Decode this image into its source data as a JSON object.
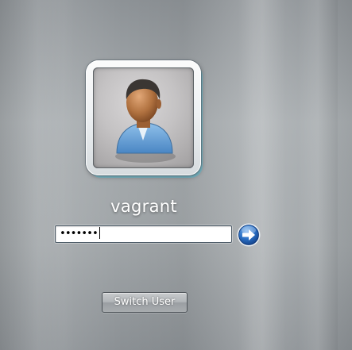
{
  "user": {
    "name": "vagrant"
  },
  "password_field": {
    "masked_value": "•••••••"
  },
  "submit": {
    "icon": "arrow-right-icon"
  },
  "switch_user": {
    "label": "Switch User"
  },
  "avatar": {
    "icon": "user-avatar-icon"
  },
  "colors": {
    "background": "#a1a6a9",
    "go_button": "#1f5fb8",
    "tile_glow": "#5fcde6"
  }
}
